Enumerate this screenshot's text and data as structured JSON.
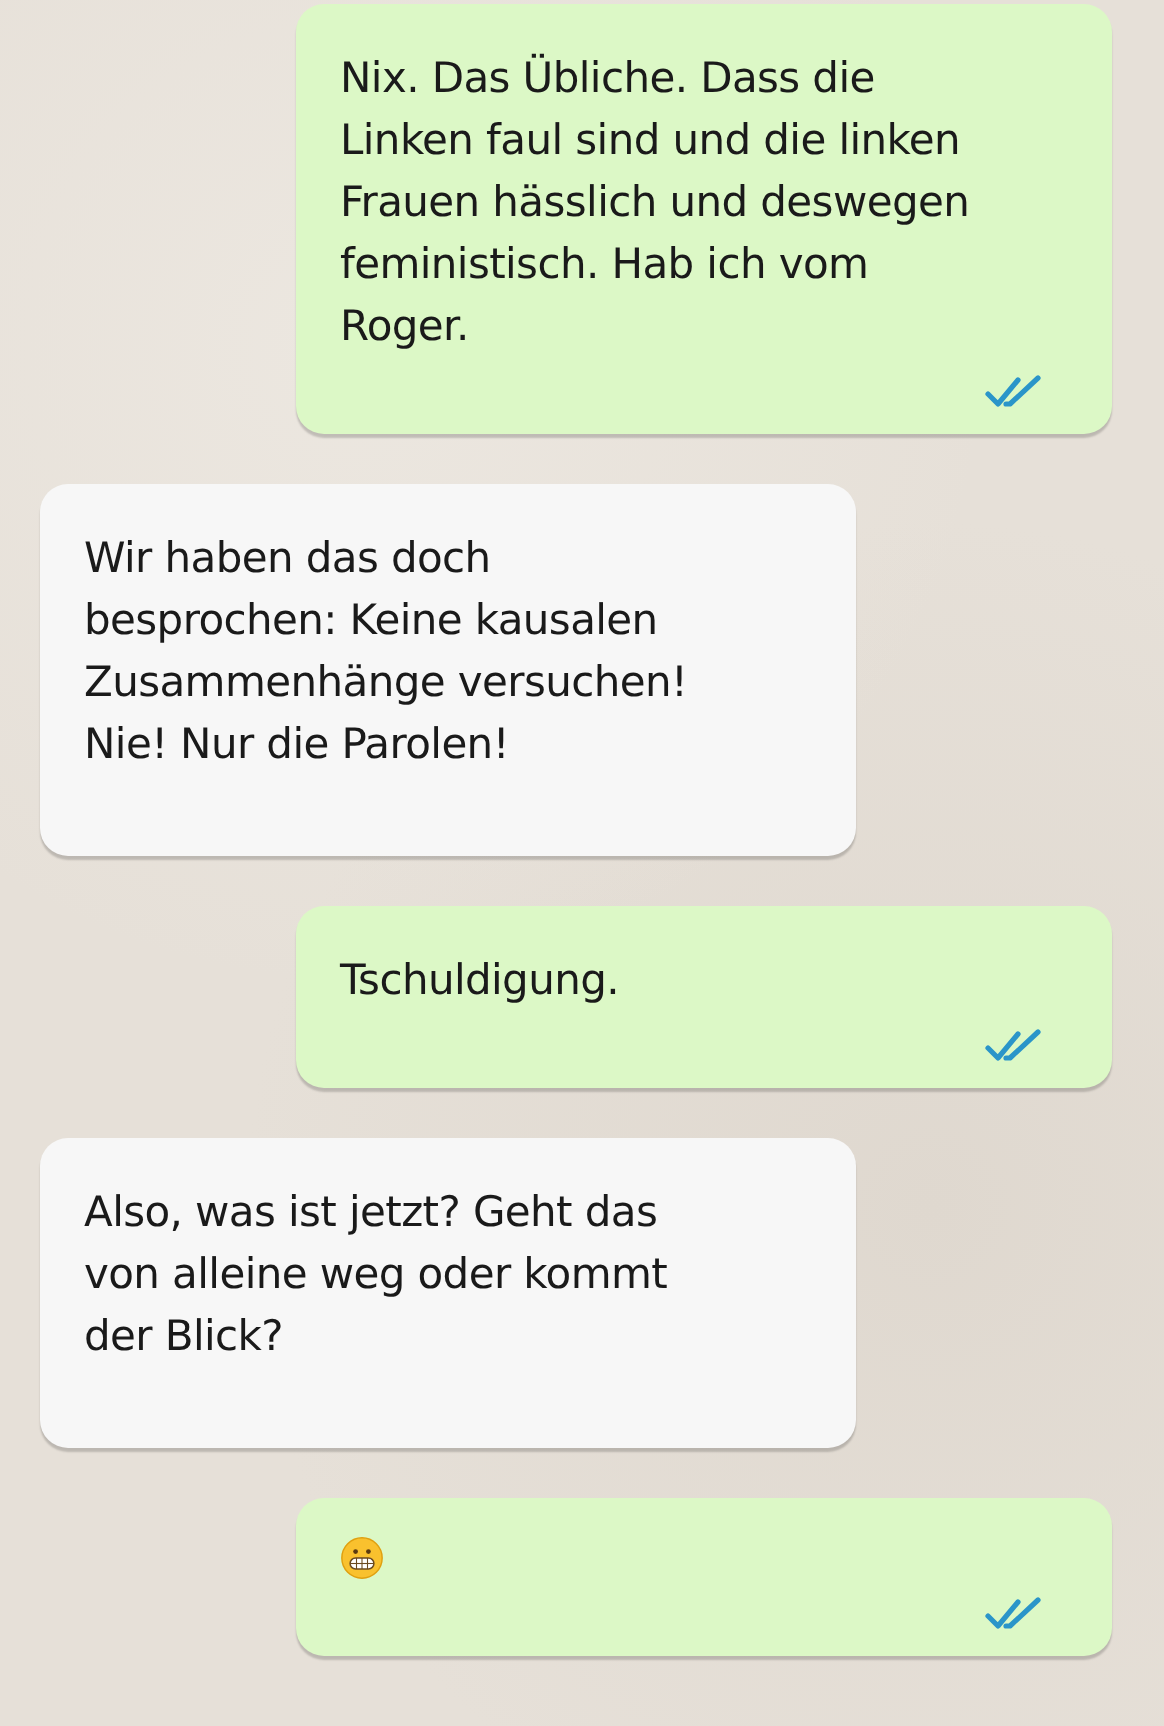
{
  "messages": [
    {
      "kind": "text",
      "sent": true,
      "text": "Nix. Das Übliche. Dass die\nLinken faul sind und die linken\nFrauen hässlich und deswegen\nfeministisch. Hab ich vom\nRoger.",
      "read": true
    },
    {
      "kind": "text",
      "sent": false,
      "text": "Wir haben das doch\nbesprochen: Keine kausalen\nZusammenhänge versuchen!\nNie! Nur die Parolen!"
    },
    {
      "kind": "text",
      "sent": true,
      "text": "Tschuldigung.",
      "read": true
    },
    {
      "kind": "text",
      "sent": false,
      "text": "Also, was ist jetzt? Geht das\nvon alleine weg oder kommt\nder Blick?"
    },
    {
      "kind": "emoji",
      "sent": true,
      "read": true
    }
  ]
}
